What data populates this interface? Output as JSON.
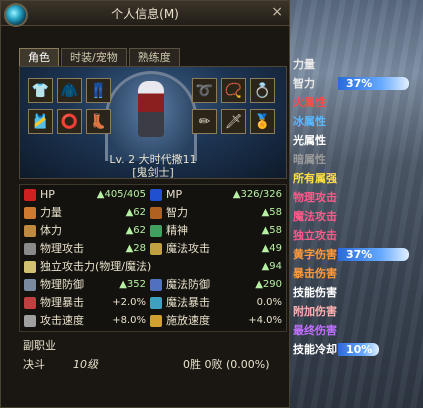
{
  "window": {
    "title": "个人信息(M)",
    "close": "×"
  },
  "tabs": [
    "角色",
    "时装/宠物",
    "熟练度"
  ],
  "character": {
    "level_line": "Lv. 2 大时代撒11",
    "class_line": "[鬼剑士]"
  },
  "stats": {
    "hp": {
      "label": "HP",
      "value": "405/405"
    },
    "mp": {
      "label": "MP",
      "value": "326/326"
    },
    "str": {
      "label": "力量",
      "value": "62"
    },
    "int": {
      "label": "智力",
      "value": "58"
    },
    "vit": {
      "label": "体力",
      "value": "62"
    },
    "spr": {
      "label": "精神",
      "value": "58"
    },
    "patk": {
      "label": "物理攻击",
      "value": "28"
    },
    "matk": {
      "label": "魔法攻击",
      "value": "49"
    },
    "iatk": {
      "label": "独立攻击力(物理/魔法)",
      "value": "94"
    },
    "pdef": {
      "label": "物理防御",
      "value": "352"
    },
    "mdef": {
      "label": "魔法防御",
      "value": "290"
    },
    "pcrit": {
      "label": "物理暴击",
      "value": "+2.0%"
    },
    "mcrit": {
      "label": "魔法暴击",
      "value": "0.0%"
    },
    "aspd": {
      "label": "攻击速度",
      "value": "+8.0%"
    },
    "cspd": {
      "label": "施放速度",
      "value": "+4.0%"
    }
  },
  "subjob": {
    "title": "副职业"
  },
  "duel": {
    "label": "决斗",
    "grade": "10级",
    "record": "0胜 0败  (0.00%)"
  },
  "right_list": [
    {
      "text": "力量",
      "color": "#e8e8e8"
    },
    {
      "text": "智力",
      "color": "#e8e8e8",
      "pct": "37%",
      "bar": 0.37
    },
    {
      "text": "火属性",
      "color": "#ff4848"
    },
    {
      "text": "冰属性",
      "color": "#58b8ff"
    },
    {
      "text": "光属性",
      "color": "#ffffff"
    },
    {
      "text": "暗属性",
      "color": "#9a9a9a"
    },
    {
      "text": "所有属强",
      "color": "#ffe040"
    },
    {
      "text": "物理攻击",
      "color": "#ff5a8a"
    },
    {
      "text": "魔法攻击",
      "color": "#ff5a8a"
    },
    {
      "text": "独立攻击",
      "color": "#ff5a8a"
    },
    {
      "text": "黄字伤害",
      "color": "#ff9a3a",
      "pct": "37%",
      "bar": 0.37
    },
    {
      "text": "暴击伤害",
      "color": "#ff9a3a"
    },
    {
      "text": "技能伤害",
      "color": "#ffffff"
    },
    {
      "text": "附加伤害",
      "color": "#ffb0b0"
    },
    {
      "text": "最终伤害",
      "color": "#c070ff"
    },
    {
      "text": "技能冷却",
      "color": "#ffffff",
      "pct": "10%",
      "bar": 0.1
    }
  ],
  "colors": {
    "panel_border": "#4f4636",
    "accent_gold": "#8a7c5d",
    "stat_value_green": "#b7f0a4"
  }
}
